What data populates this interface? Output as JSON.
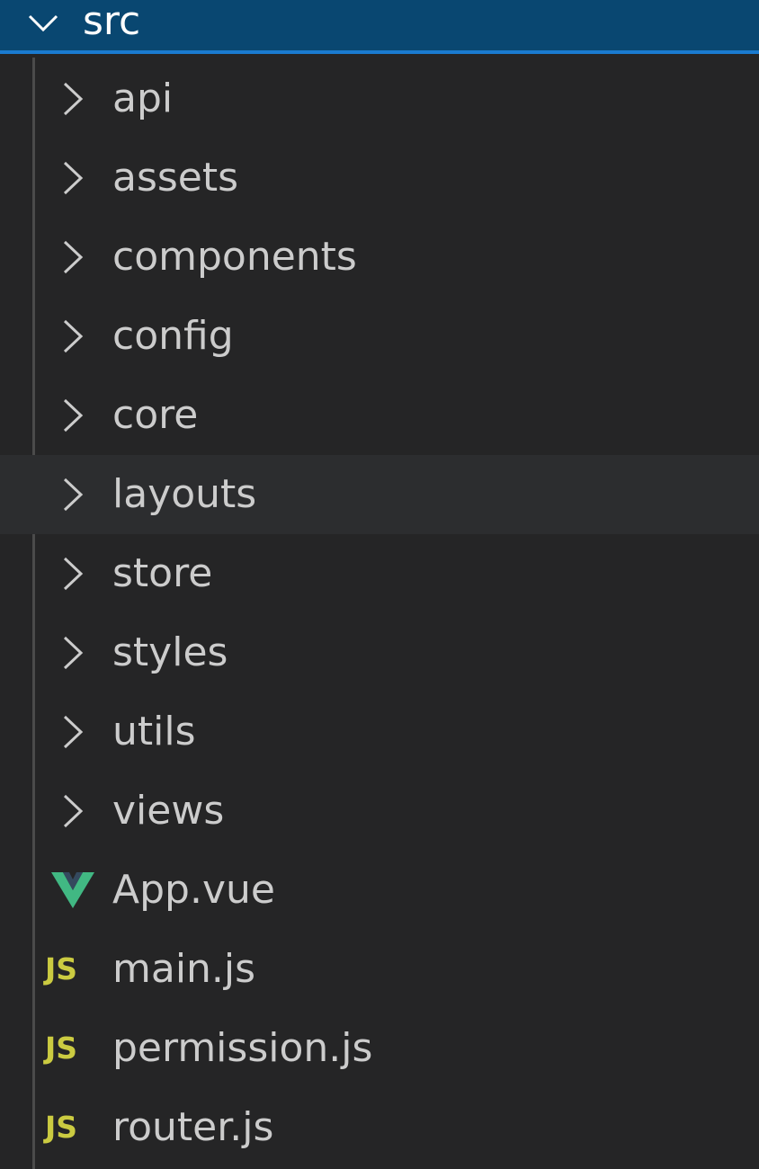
{
  "root": {
    "label": "src",
    "expanded": true,
    "chevron_icon": "chevron-down-icon"
  },
  "folders": [
    {
      "label": "api",
      "icon": "chevron-right-icon"
    },
    {
      "label": "assets",
      "icon": "chevron-right-icon"
    },
    {
      "label": "components",
      "icon": "chevron-right-icon"
    },
    {
      "label": "config",
      "icon": "chevron-right-icon"
    },
    {
      "label": "core",
      "icon": "chevron-right-icon"
    },
    {
      "label": "layouts",
      "icon": "chevron-right-icon",
      "hovered": true
    },
    {
      "label": "store",
      "icon": "chevron-right-icon"
    },
    {
      "label": "styles",
      "icon": "chevron-right-icon"
    },
    {
      "label": "utils",
      "icon": "chevron-right-icon"
    },
    {
      "label": "views",
      "icon": "chevron-right-icon"
    }
  ],
  "files": [
    {
      "label": "App.vue",
      "icon": "vue-icon"
    },
    {
      "label": "main.js",
      "icon": "js-icon",
      "badge": "JS"
    },
    {
      "label": "permission.js",
      "icon": "js-icon",
      "badge": "JS"
    },
    {
      "label": "router.js",
      "icon": "js-icon",
      "badge": "JS"
    }
  ],
  "colors": {
    "background": "#252526",
    "selected_row": "#094771",
    "selected_border": "#1a7bd0",
    "hover_row": "#2c2d2f",
    "text": "#cccccc",
    "vue_green": "#41b883",
    "js_yellow": "#cbcb41"
  }
}
